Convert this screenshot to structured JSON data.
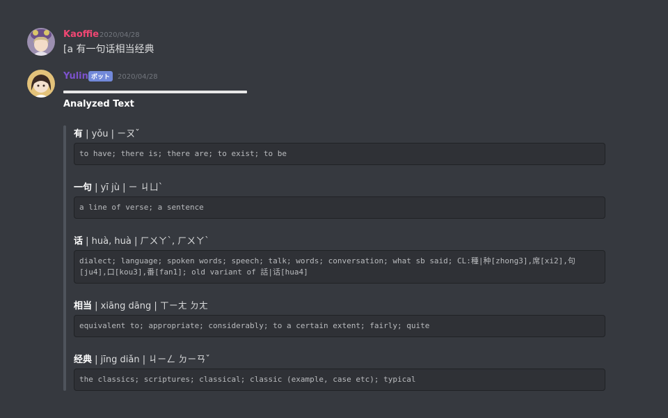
{
  "messages": [
    {
      "username": "Kaoffie",
      "timestamp": "2020/04/28",
      "content": "[a 有一句话相当经典",
      "name_color": "#f04773"
    },
    {
      "username": "Yulin",
      "bot_badge": "ボット",
      "timestamp": "2020/04/28",
      "name_color": "#7c52cc",
      "embed_title": "Analyzed Text",
      "entries": [
        {
          "word": "有",
          "info": " | yǒu | ㄧㄡˇ",
          "definition": "to have; there is; there are; to exist; to be"
        },
        {
          "word": "一句",
          "info": " | yī jù | ㄧ ㄐㄩˋ",
          "definition": "a line of verse; a sentence"
        },
        {
          "word": "话",
          "info": " | huà, huà | ㄏㄨㄚˋ, ㄏㄨㄚˋ",
          "definition": "dialect; language; spoken words; speech; talk; words; conversation; what sb said; CL:種|种[zhong3],席[xi2],句[ju4],口[kou3],番[fan1]; old variant of 話|话[hua4]"
        },
        {
          "word": "相当",
          "info": " | xiāng dāng | ㄒㄧㄤ ㄉㄤ",
          "definition": "equivalent to; appropriate; considerably; to a certain extent; fairly; quite"
        },
        {
          "word": "经典",
          "info": " | jīng diǎn | ㄐㄧㄥ ㄉㄧㄢˇ",
          "definition": "the classics; scriptures; classical; classic (example, case etc); typical"
        }
      ]
    }
  ]
}
